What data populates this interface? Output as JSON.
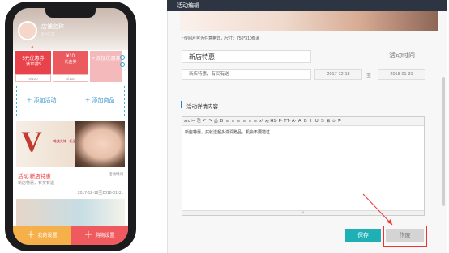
{
  "phone": {
    "header": {
      "name": "店铺名称",
      "sub": "粉丝:21"
    },
    "coupons": [
      {
        "title": "5元优惠券",
        "sub": "满10减5",
        "count": "5/100"
      },
      {
        "title": "¥10",
        "sub": "代金券",
        "count": "4/100"
      },
      {
        "title": "+ 添加优惠券",
        "sub": "",
        "count": ""
      }
    ],
    "add_activity": "添加活动",
    "add_goods": "添加商品",
    "banner_text": "唯美先锋 · 新品上市",
    "activity": {
      "title": "活动:新店特惠",
      "tag": "活动时间",
      "desc": "新店特惠，有买有送",
      "date": "2017-12-18至2018-01-31"
    },
    "footer": {
      "left": "我的设置",
      "right": "购物设置"
    }
  },
  "editor": {
    "title": "活动编辑",
    "upload_hint": "上传图片可为任意格式，尺寸：750*310像素",
    "name_value": "新店特惠",
    "time_label": "活动时间",
    "desc_value": "新店特惠，有买有送",
    "start_date": "2017-12-18",
    "date_sep": "至",
    "end_date": "2018-01-31",
    "detail_title": "活动详情内容",
    "detail_body": "新店特惠，买就送超多滋润赠品，机会不要错过",
    "status_mark": "+",
    "toolbar": [
      "src",
      "✂",
      "⎘",
      "↶",
      "↷",
      "⎙",
      "B",
      "≡",
      "≡",
      "≡",
      "≡",
      "≡",
      "≡",
      "x²",
      "x₂",
      "H1·",
      "F·",
      "TT·",
      "A·",
      "A",
      "B",
      "I",
      "U",
      "S",
      "⊞",
      "☺",
      "⚑"
    ],
    "save_label": "保存",
    "void_label": "作废"
  },
  "colors": {
    "accent": "#1fb0b6",
    "topbar": "#2e3542",
    "red": "#e8424a",
    "highlight": "#e33333"
  }
}
